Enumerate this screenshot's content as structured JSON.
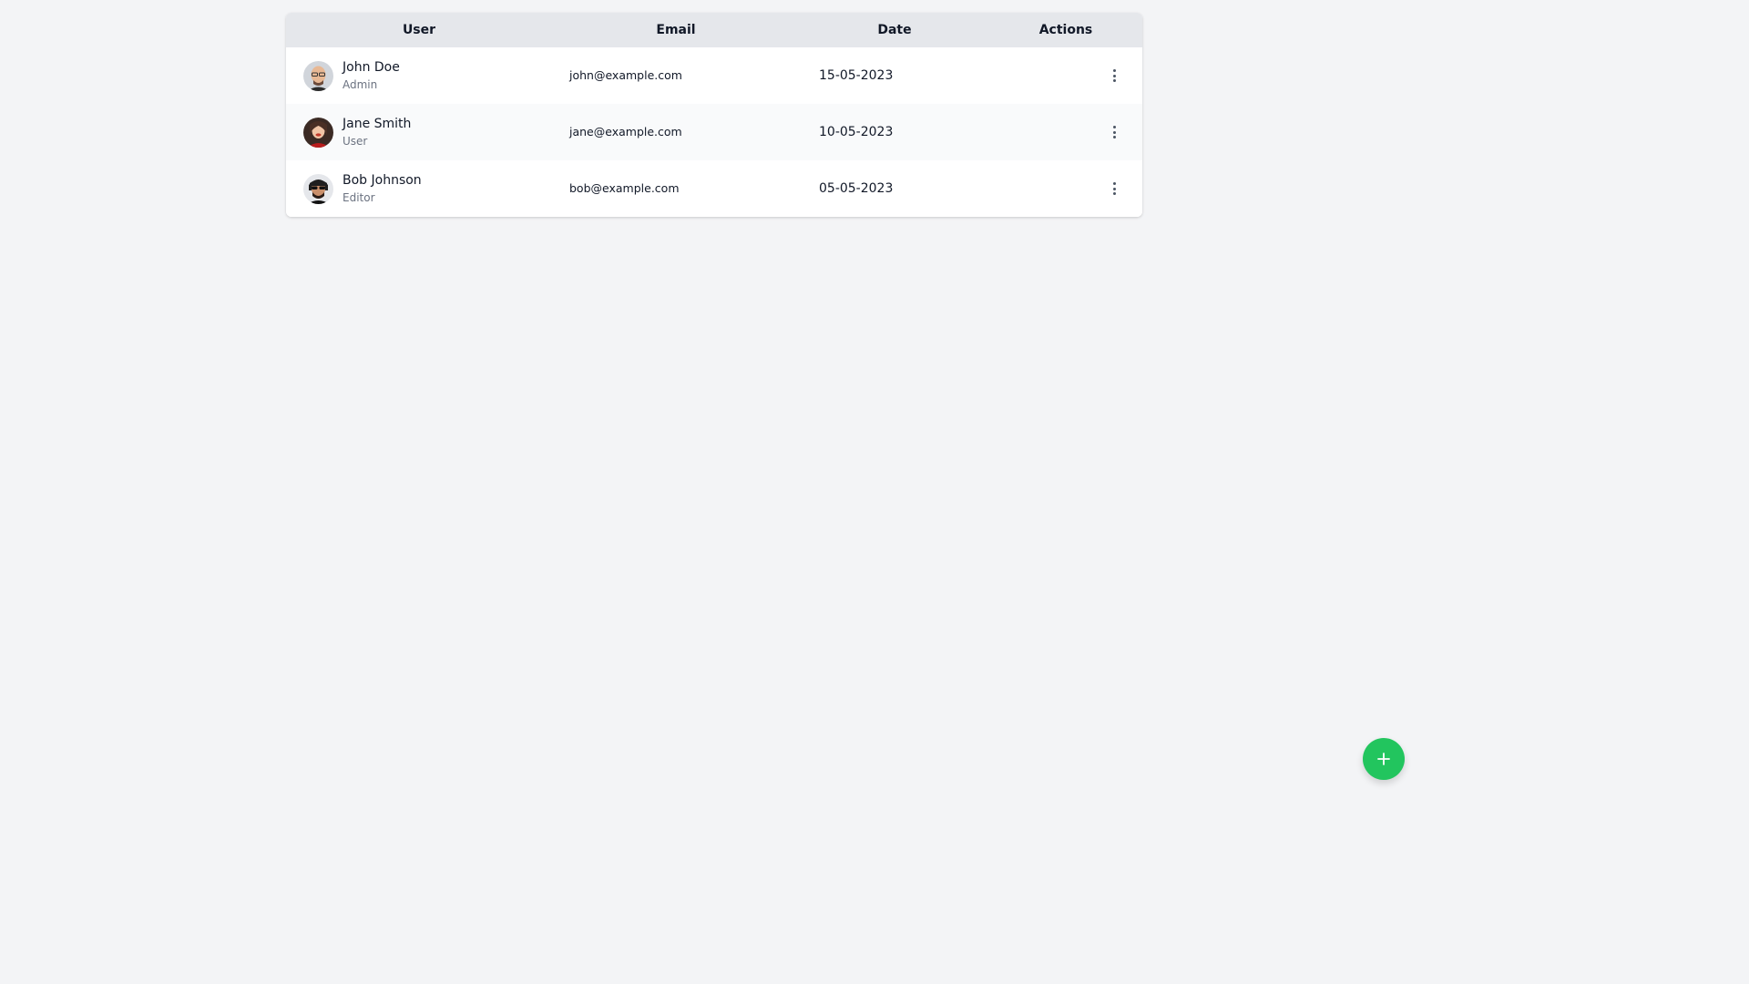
{
  "table": {
    "headers": {
      "user": "User",
      "email": "Email",
      "date": "Date",
      "actions": "Actions"
    },
    "rows": [
      {
        "name": "John Doe",
        "role": "Admin",
        "email": "john@example.com",
        "date": "15-05-2023",
        "avatar_icon": "avatar-bald-man-glasses"
      },
      {
        "name": "Jane Smith",
        "role": "User",
        "email": "jane@example.com",
        "date": "10-05-2023",
        "avatar_icon": "avatar-woman-red-top"
      },
      {
        "name": "Bob Johnson",
        "role": "Editor",
        "email": "bob@example.com",
        "date": "05-05-2023",
        "avatar_icon": "avatar-man-sunglasses"
      }
    ],
    "row_action_icon": "more-vertical-icon"
  },
  "fab": {
    "icon": "plus-icon",
    "color": "#22c55e"
  },
  "colors": {
    "background": "#f3f4f6",
    "header_bg": "#e5e7eb",
    "row_alt_bg": "#f9fafb",
    "muted_text": "#6b7280"
  }
}
